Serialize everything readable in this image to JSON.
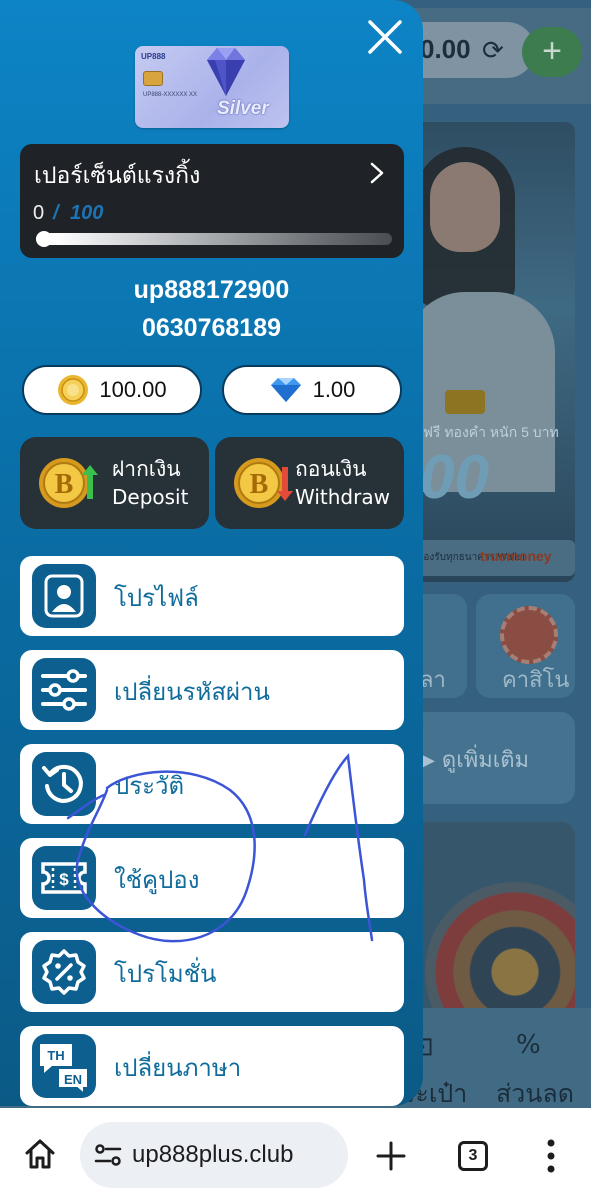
{
  "background": {
    "balance": "0.00",
    "hero_gold_text": "ฟรี ทองคำ หนัก 5 บาท",
    "hero_big_text": "00",
    "wallet_text": "รองรับทุกธนาคาร Wallet",
    "truemoney_text": "truemoney",
    "card_left_label": "ลา",
    "card_casino_label": "คาสิโน",
    "see_more_label": "ดูเพิ่มเติม",
    "nav_wallet_label": "ระเป๋า",
    "nav_discount_label": "ส่วนลด"
  },
  "drawer": {
    "vip_card": {
      "brand": "UP888",
      "number": "UP888-XXXXXX XX",
      "level": "Silver"
    },
    "rank": {
      "title": "เปอร์เซ็นต์แรงกิ้ง",
      "current": "0",
      "separator": "/",
      "max": "100",
      "progress": 0
    },
    "username": "up888172900",
    "phone": "0630768189",
    "coin_balance": "100.00",
    "diamond_balance": "1.00",
    "deposit": {
      "th": "ฝากเงิน",
      "en": "Deposit"
    },
    "withdraw": {
      "th": "ถอนเงิน",
      "en": "Withdraw"
    },
    "menu": [
      {
        "label": "โปรไฟล์",
        "icon": "profile-icon"
      },
      {
        "label": "เปลี่ยนรหัสผ่าน",
        "icon": "sliders-icon"
      },
      {
        "label": "ประวัติ",
        "icon": "history-icon"
      },
      {
        "label": "ใช้คูปอง",
        "icon": "coupon-icon"
      },
      {
        "label": "โปรโมชั่น",
        "icon": "promotion-icon"
      },
      {
        "label": "เปลี่ยนภาษา",
        "icon": "language-icon",
        "icon_text_top": "TH",
        "icon_text_bottom": "EN"
      }
    ]
  },
  "browser": {
    "url": "up888plus.club",
    "tab_count": "3"
  },
  "colors": {
    "drawer_top": "#0d84c6",
    "drawer_bottom": "#0b5a86",
    "menu_text": "#0f6c9c",
    "scribble": "#3b55d6"
  }
}
